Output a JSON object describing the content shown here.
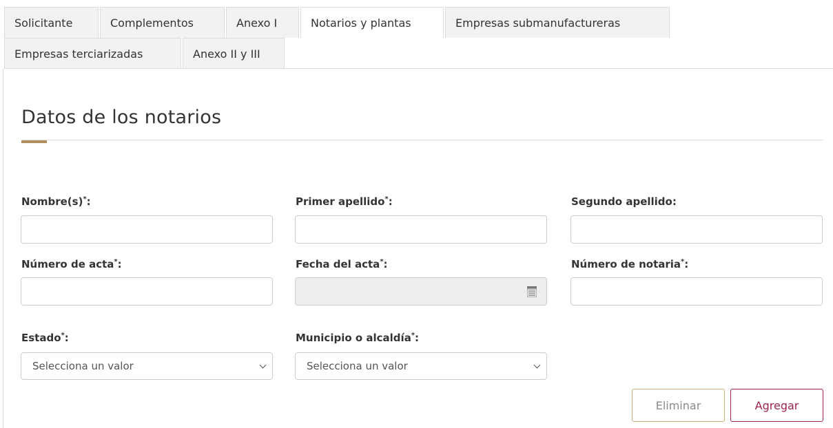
{
  "tabs": {
    "row1": [
      "Solicitante",
      "Complementos",
      "Anexo I",
      "Notarios y plantas",
      "Empresas submanufactureras"
    ],
    "row2": [
      "Empresas terciarizadas",
      "Anexo II y III"
    ],
    "active": "Notarios y plantas"
  },
  "section": {
    "title": "Datos de los notarios"
  },
  "fields": {
    "nombre": {
      "label": "Nombre(s)",
      "required": "*",
      "value": ""
    },
    "primer_apellido": {
      "label": "Primer apellido",
      "required": "*",
      "value": ""
    },
    "segundo_apellido": {
      "label": "Segundo apellido:",
      "value": ""
    },
    "numero_acta": {
      "label": "Número de acta",
      "required": "*",
      "value": ""
    },
    "fecha_acta": {
      "label": "Fecha del acta",
      "required": "*",
      "value": ""
    },
    "numero_notaria": {
      "label": "Número de notaria",
      "required": "*",
      "value": ""
    },
    "estado": {
      "label": "Estado",
      "required": "*",
      "selected": "Selecciona un valor"
    },
    "municipio": {
      "label": "Municipio o alcaldía",
      "required": "*",
      "selected": "Selecciona un valor"
    }
  },
  "buttons": {
    "eliminar": "Eliminar",
    "agregar": "Agregar"
  },
  "colors": {
    "accent_gold": "#b38e5d",
    "primary_maroon": "#9d2449",
    "border": "#cccccc"
  },
  "icons": {
    "date_picker": "calendar-icon",
    "select": "chevron-down-icon"
  }
}
